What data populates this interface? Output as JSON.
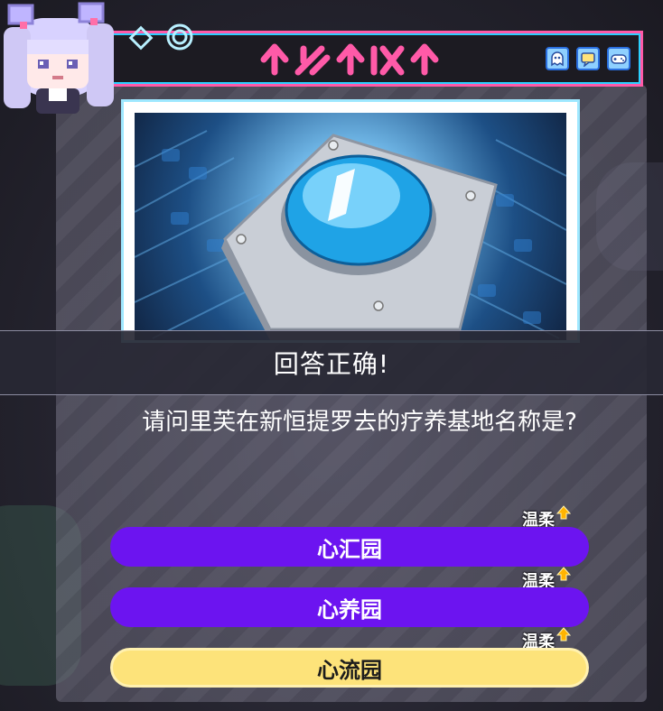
{
  "header": {
    "title_glyphs": "↑↓↑↕↑",
    "icons": [
      "ghost-icon",
      "chat-icon",
      "gamepad-icon"
    ]
  },
  "result": {
    "text": "回答正确!"
  },
  "question": {
    "text": "请问里芙在新恒提罗去的疗养基地名称是?"
  },
  "answers": [
    {
      "label": "心汇园",
      "trait": "温柔",
      "state": "default"
    },
    {
      "label": "心养园",
      "trait": "温柔",
      "state": "default"
    },
    {
      "label": "心流园",
      "trait": "温柔",
      "state": "selected"
    }
  ],
  "colors": {
    "header_border": "#ff5aa8",
    "answer_default": "#6c14f0",
    "answer_selected": "#fde37a",
    "trait_arrow": "#ffb400"
  }
}
